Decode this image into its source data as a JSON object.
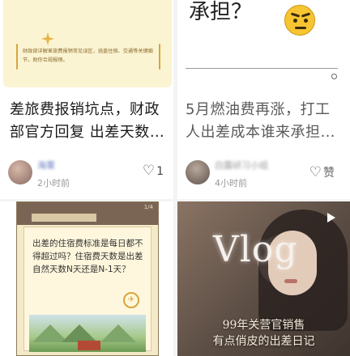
{
  "cards": [
    {
      "cover_note": "财政部详解差旅费报销常见误区，涵盖住宿、交通等关键细节，助你合规报销。",
      "title": "差旅费报销坑点，财政部官方回复 出差天数…",
      "author": "海栗",
      "time": "2小时前",
      "likes": "1"
    },
    {
      "cover_heading": "承担？",
      "title": "5月燃油费再涨，打工人出差成本谁来承担…",
      "author": "白露研习小组",
      "time": "4小时前",
      "likes": "赞"
    },
    {
      "cover_page": "1/4",
      "cover_question": "出差的住宿费标准是每日都不得超过吗？住宿费天数是出差自然天数N天还是N-1天？"
    },
    {
      "cover_title": "Vlog",
      "caption_line1": "99年关营官销售",
      "caption_line2": "有点俏皮的出差日记"
    }
  ]
}
